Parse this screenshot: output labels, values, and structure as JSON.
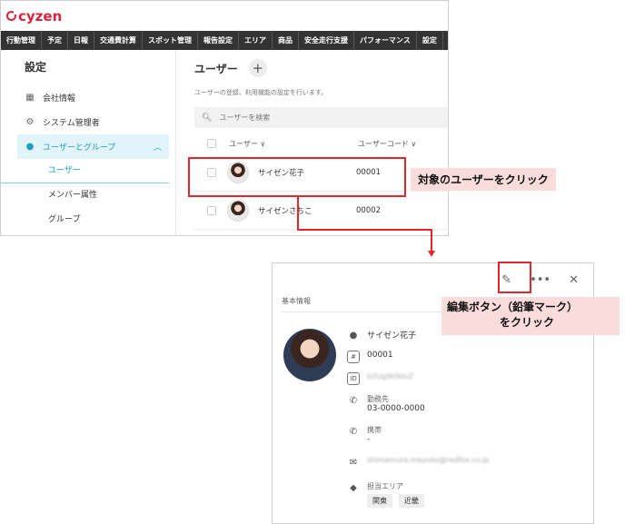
{
  "app": {
    "logo": "cyzen",
    "nav": [
      "行動管理",
      "予定",
      "日報",
      "交通費計算",
      "スポット管理",
      "報告設定",
      "エリア",
      "商品",
      "安全走行支援",
      "パフォーマンス",
      "設定"
    ]
  },
  "sidebar": {
    "title": "設定",
    "items": [
      {
        "label": "会社情報",
        "icon": "building-icon"
      },
      {
        "label": "システム管理者",
        "icon": "admin-user-icon"
      },
      {
        "label": "ユーザーとグループ",
        "icon": "user-icon"
      }
    ],
    "subitems": [
      "ユーザー",
      "メンバー属性",
      "グループ"
    ]
  },
  "main": {
    "title": "ユーザー",
    "add": "+",
    "description": "ユーザーの登録、利用機能の設定を行います。",
    "search_placeholder": "ユーザーを検索",
    "columns": [
      "ユーザー ∨",
      "ユーザーコード ∨"
    ],
    "rows": [
      {
        "name": "サイゼン花子",
        "code": "00001"
      },
      {
        "name": "サイゼンさちこ",
        "code": "00002"
      }
    ]
  },
  "callouts": {
    "select_user": "対象のユーザーをクリック",
    "edit_button_line1": "編集ボタン（鉛筆マーク）",
    "edit_button_line2": "をクリック"
  },
  "panel": {
    "section": "基本情報",
    "name": "サイゼン花子",
    "code": "00001",
    "id_value": "b2Ug9k9dvZ",
    "work_label": "勤務先",
    "work_phone": "03-0000-0000",
    "mobile_label": "携帯",
    "mobile_phone": "-",
    "email": "shimamura.mayuko@redfox.co.jp",
    "area_label": "担当エリア",
    "areas": [
      "関東",
      "近畿"
    ]
  },
  "colors": {
    "accent": "#1a9fc0",
    "highlight": "#e4252f",
    "callout_bg": "#fbdcdc",
    "brand": "#d9233d"
  }
}
